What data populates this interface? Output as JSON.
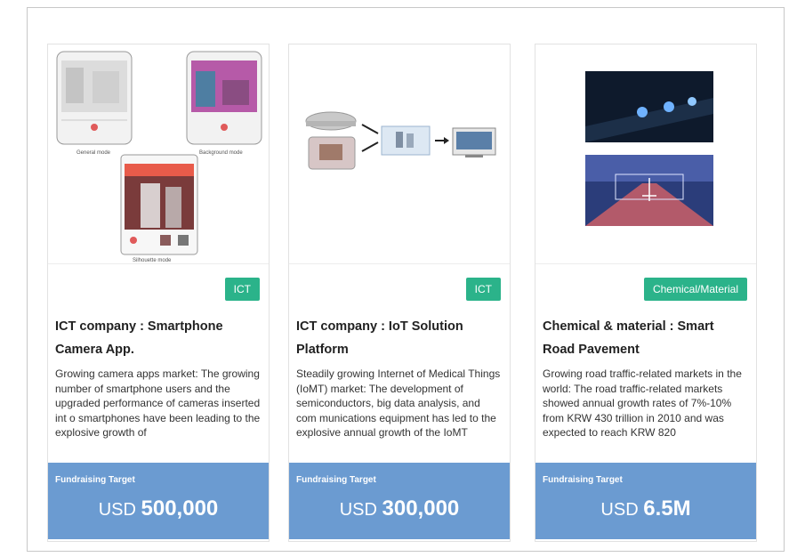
{
  "cards": [
    {
      "badge": "ICT",
      "title": "ICT company : Smartphone Camera App.",
      "desc": "Growing camera apps market: The growing number of smartphone users and the upgraded performance of cameras inserted int o smartphones have been leading to the explosive growth of",
      "fund_label": "Fundraising Target",
      "currency": "USD",
      "amount": "500,000",
      "image_labels": [
        "General mode",
        "Background mode",
        "Silhouette mode"
      ]
    },
    {
      "badge": "ICT",
      "title": "ICT company : IoT Solution Platform",
      "desc": "Steadily growing Internet of Medical Things (IoMT) market: The development of semiconductors, big data analysis, and com munications equipment has led to the explosive annual growth of the IoMT",
      "fund_label": "Fundraising Target",
      "currency": "USD",
      "amount": "300,000"
    },
    {
      "badge": "Chemical/Material",
      "title": "Chemical & material : Smart Road Pavement",
      "desc": "Growing road traffic-related markets in the world: The road traffic-related markets showed annual growth rates of 7%-10% from KRW 430 trillion in 2010 and was expected to reach KRW 820",
      "fund_label": "Fundraising Target",
      "currency": "USD",
      "amount": "6.5M"
    }
  ],
  "colors": {
    "badge": "#2bb38a",
    "fund_bar": "#6b9bd1"
  }
}
